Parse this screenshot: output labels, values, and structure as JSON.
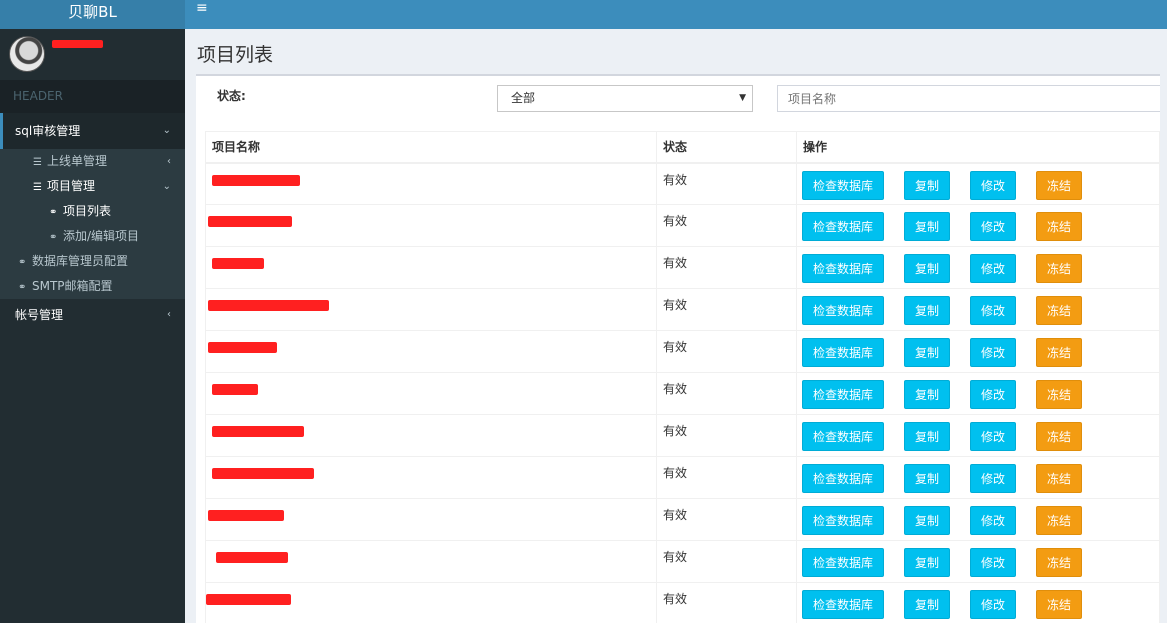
{
  "app": {
    "logo": "贝聊BL"
  },
  "sidebar": {
    "header": "HEADER",
    "menu": {
      "sql_audit": "sql审核管理",
      "release_mgmt": "上线单管理",
      "project_mgmt": "项目管理",
      "project_list": "项目列表",
      "project_edit": "添加/编辑项目",
      "db_admin_config": "数据库管理员配置",
      "smtp_config": "SMTP邮箱配置",
      "account_mgmt": "帐号管理"
    }
  },
  "page": {
    "title": "项目列表"
  },
  "filter": {
    "status_label": "状态:",
    "status_selected": "全部",
    "name_placeholder": "项目名称"
  },
  "table": {
    "headers": {
      "name": "项目名称",
      "status": "状态",
      "ops": "操作"
    },
    "buttons": {
      "check_db": "检查数据库",
      "copy": "复制",
      "edit": "修改",
      "freeze": "冻结"
    },
    "rows": [
      {
        "status": "有效"
      },
      {
        "status": "有效"
      },
      {
        "status": "有效"
      },
      {
        "status": "有效"
      },
      {
        "status": "有效"
      },
      {
        "status": "有效"
      },
      {
        "status": "有效"
      },
      {
        "status": "有效"
      },
      {
        "status": "有效"
      },
      {
        "status": "有效"
      },
      {
        "status": "有效"
      }
    ]
  },
  "colors": {
    "primary": "#3c8dbc",
    "info": "#00c0ef",
    "warning": "#f39c12",
    "sidebar": "#222d32",
    "redaction": "#ff2020"
  }
}
